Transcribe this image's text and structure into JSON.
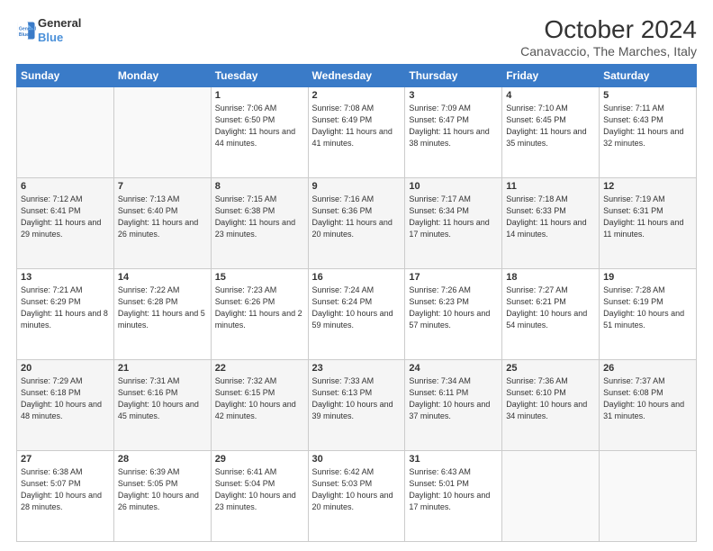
{
  "header": {
    "logo_line1": "General",
    "logo_line2": "Blue",
    "title": "October 2024",
    "subtitle": "Canavaccio, The Marches, Italy"
  },
  "days_of_week": [
    "Sunday",
    "Monday",
    "Tuesday",
    "Wednesday",
    "Thursday",
    "Friday",
    "Saturday"
  ],
  "weeks": [
    [
      {
        "num": "",
        "info": ""
      },
      {
        "num": "",
        "info": ""
      },
      {
        "num": "1",
        "info": "Sunrise: 7:06 AM\nSunset: 6:50 PM\nDaylight: 11 hours and 44 minutes."
      },
      {
        "num": "2",
        "info": "Sunrise: 7:08 AM\nSunset: 6:49 PM\nDaylight: 11 hours and 41 minutes."
      },
      {
        "num": "3",
        "info": "Sunrise: 7:09 AM\nSunset: 6:47 PM\nDaylight: 11 hours and 38 minutes."
      },
      {
        "num": "4",
        "info": "Sunrise: 7:10 AM\nSunset: 6:45 PM\nDaylight: 11 hours and 35 minutes."
      },
      {
        "num": "5",
        "info": "Sunrise: 7:11 AM\nSunset: 6:43 PM\nDaylight: 11 hours and 32 minutes."
      }
    ],
    [
      {
        "num": "6",
        "info": "Sunrise: 7:12 AM\nSunset: 6:41 PM\nDaylight: 11 hours and 29 minutes."
      },
      {
        "num": "7",
        "info": "Sunrise: 7:13 AM\nSunset: 6:40 PM\nDaylight: 11 hours and 26 minutes."
      },
      {
        "num": "8",
        "info": "Sunrise: 7:15 AM\nSunset: 6:38 PM\nDaylight: 11 hours and 23 minutes."
      },
      {
        "num": "9",
        "info": "Sunrise: 7:16 AM\nSunset: 6:36 PM\nDaylight: 11 hours and 20 minutes."
      },
      {
        "num": "10",
        "info": "Sunrise: 7:17 AM\nSunset: 6:34 PM\nDaylight: 11 hours and 17 minutes."
      },
      {
        "num": "11",
        "info": "Sunrise: 7:18 AM\nSunset: 6:33 PM\nDaylight: 11 hours and 14 minutes."
      },
      {
        "num": "12",
        "info": "Sunrise: 7:19 AM\nSunset: 6:31 PM\nDaylight: 11 hours and 11 minutes."
      }
    ],
    [
      {
        "num": "13",
        "info": "Sunrise: 7:21 AM\nSunset: 6:29 PM\nDaylight: 11 hours and 8 minutes."
      },
      {
        "num": "14",
        "info": "Sunrise: 7:22 AM\nSunset: 6:28 PM\nDaylight: 11 hours and 5 minutes."
      },
      {
        "num": "15",
        "info": "Sunrise: 7:23 AM\nSunset: 6:26 PM\nDaylight: 11 hours and 2 minutes."
      },
      {
        "num": "16",
        "info": "Sunrise: 7:24 AM\nSunset: 6:24 PM\nDaylight: 10 hours and 59 minutes."
      },
      {
        "num": "17",
        "info": "Sunrise: 7:26 AM\nSunset: 6:23 PM\nDaylight: 10 hours and 57 minutes."
      },
      {
        "num": "18",
        "info": "Sunrise: 7:27 AM\nSunset: 6:21 PM\nDaylight: 10 hours and 54 minutes."
      },
      {
        "num": "19",
        "info": "Sunrise: 7:28 AM\nSunset: 6:19 PM\nDaylight: 10 hours and 51 minutes."
      }
    ],
    [
      {
        "num": "20",
        "info": "Sunrise: 7:29 AM\nSunset: 6:18 PM\nDaylight: 10 hours and 48 minutes."
      },
      {
        "num": "21",
        "info": "Sunrise: 7:31 AM\nSunset: 6:16 PM\nDaylight: 10 hours and 45 minutes."
      },
      {
        "num": "22",
        "info": "Sunrise: 7:32 AM\nSunset: 6:15 PM\nDaylight: 10 hours and 42 minutes."
      },
      {
        "num": "23",
        "info": "Sunrise: 7:33 AM\nSunset: 6:13 PM\nDaylight: 10 hours and 39 minutes."
      },
      {
        "num": "24",
        "info": "Sunrise: 7:34 AM\nSunset: 6:11 PM\nDaylight: 10 hours and 37 minutes."
      },
      {
        "num": "25",
        "info": "Sunrise: 7:36 AM\nSunset: 6:10 PM\nDaylight: 10 hours and 34 minutes."
      },
      {
        "num": "26",
        "info": "Sunrise: 7:37 AM\nSunset: 6:08 PM\nDaylight: 10 hours and 31 minutes."
      }
    ],
    [
      {
        "num": "27",
        "info": "Sunrise: 6:38 AM\nSunset: 5:07 PM\nDaylight: 10 hours and 28 minutes."
      },
      {
        "num": "28",
        "info": "Sunrise: 6:39 AM\nSunset: 5:05 PM\nDaylight: 10 hours and 26 minutes."
      },
      {
        "num": "29",
        "info": "Sunrise: 6:41 AM\nSunset: 5:04 PM\nDaylight: 10 hours and 23 minutes."
      },
      {
        "num": "30",
        "info": "Sunrise: 6:42 AM\nSunset: 5:03 PM\nDaylight: 10 hours and 20 minutes."
      },
      {
        "num": "31",
        "info": "Sunrise: 6:43 AM\nSunset: 5:01 PM\nDaylight: 10 hours and 17 minutes."
      },
      {
        "num": "",
        "info": ""
      },
      {
        "num": "",
        "info": ""
      }
    ]
  ]
}
